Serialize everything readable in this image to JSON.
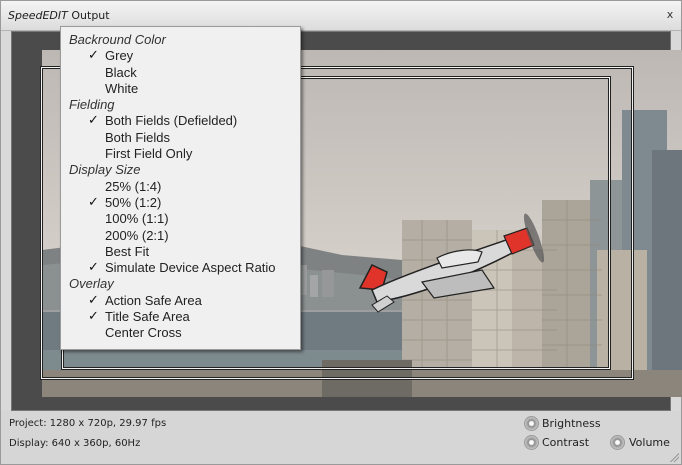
{
  "window": {
    "title_brand": "SpeedEDIT",
    "title_rest": " Output",
    "close_label": "x"
  },
  "menu": {
    "check_glyph": "✓",
    "sections": [
      {
        "header": "Backround Color",
        "items": [
          {
            "label": "Grey",
            "checked": true
          },
          {
            "label": "Black",
            "checked": false
          },
          {
            "label": "White",
            "checked": false
          }
        ]
      },
      {
        "header": "Fielding",
        "items": [
          {
            "label": "Both Fields (Defielded)",
            "checked": true
          },
          {
            "label": "Both Fields",
            "checked": false
          },
          {
            "label": "First Field Only",
            "checked": false
          }
        ]
      },
      {
        "header": "Display Size",
        "items": [
          {
            "label": "25% (1:4)",
            "checked": false
          },
          {
            "label": "50% (1:2)",
            "checked": true
          },
          {
            "label": "100% (1:1)",
            "checked": false
          },
          {
            "label": "200% (2:1)",
            "checked": false
          },
          {
            "label": "Best Fit",
            "checked": false
          },
          {
            "label": "Simulate Device Aspect Ratio",
            "checked": true
          }
        ]
      },
      {
        "header": "Overlay",
        "items": [
          {
            "label": "Action Safe Area",
            "checked": true
          },
          {
            "label": "Title Safe Area",
            "checked": true
          },
          {
            "label": "Center Cross",
            "checked": false
          }
        ]
      }
    ]
  },
  "status": {
    "project": "Project: 1280 x 720p, 29.97 fps",
    "display": "Display: 640 x 360p, 60Hz",
    "brightness_label": "Brightness",
    "contrast_label": "Contrast",
    "volume_label": "Volume"
  },
  "icons": {
    "brightness": "knob-icon",
    "contrast": "knob-icon",
    "volume": "knob-icon",
    "close": "close-icon"
  }
}
